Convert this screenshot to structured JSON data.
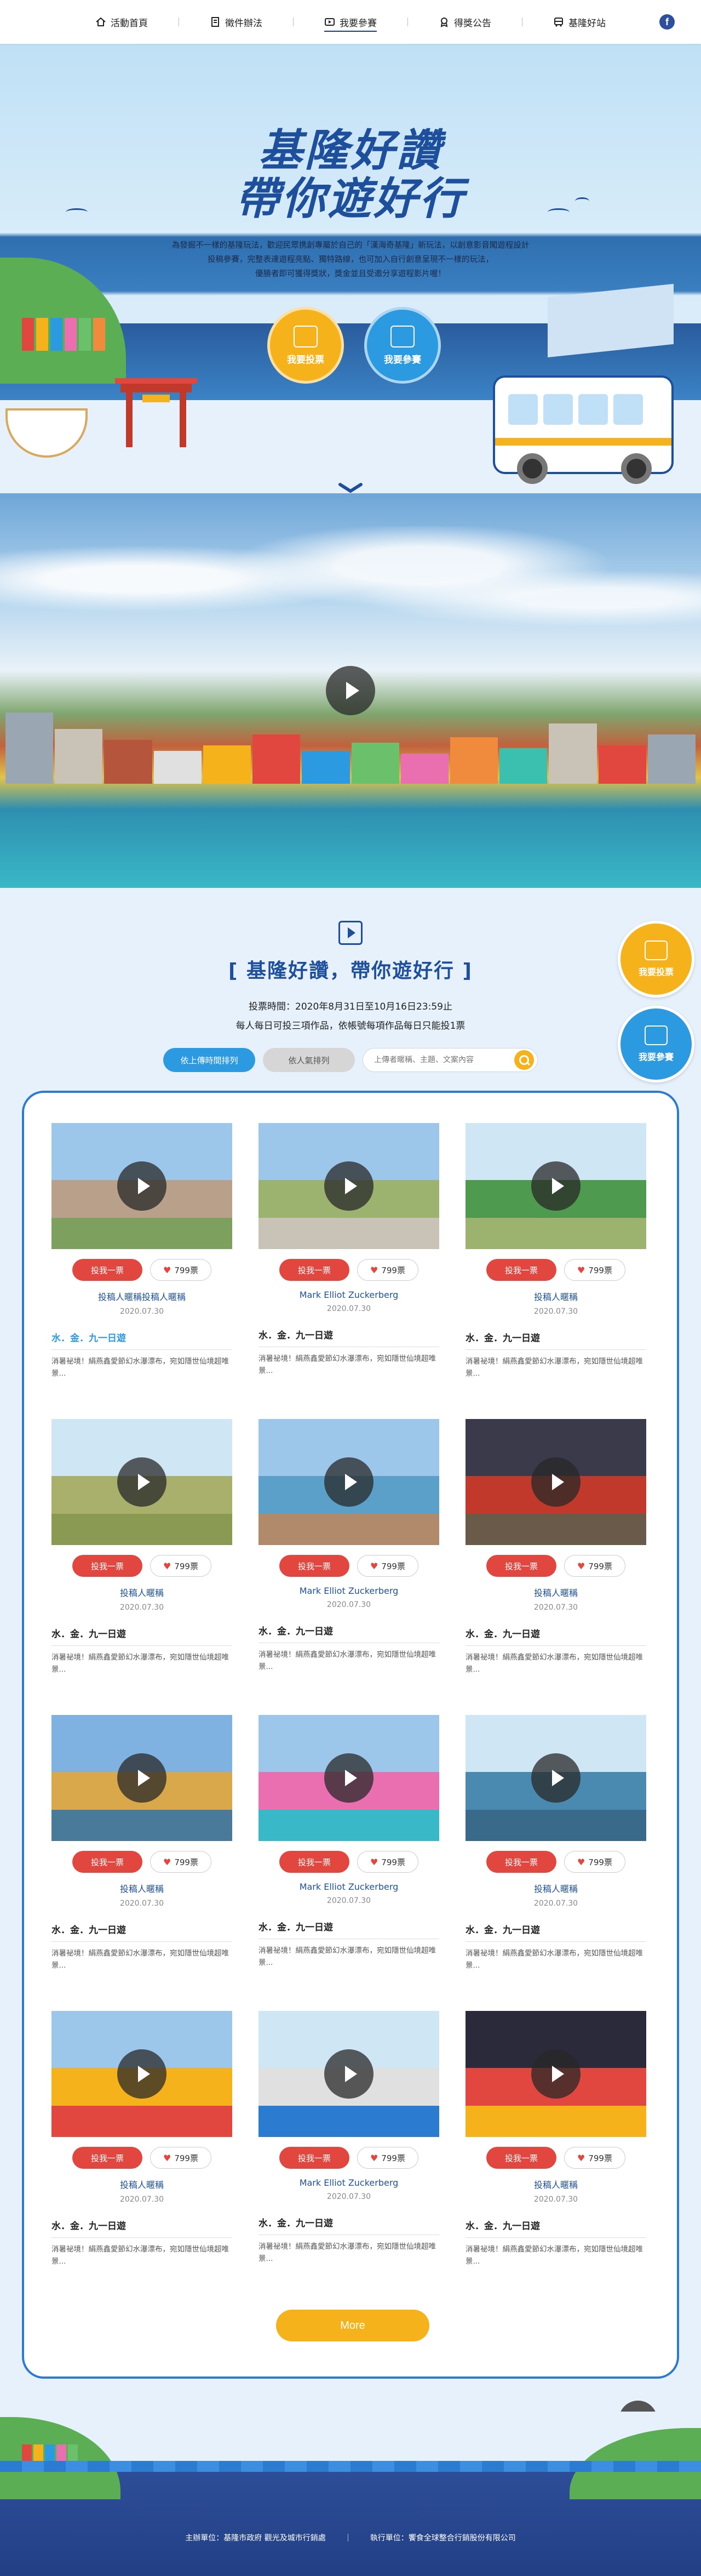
{
  "nav": {
    "items": [
      {
        "label": "活動首頁",
        "icon": "home-icon"
      },
      {
        "label": "徵件辦法",
        "icon": "document-icon"
      },
      {
        "label": "我要參賽",
        "icon": "video-icon",
        "active": true
      },
      {
        "label": "得獎公告",
        "icon": "medal-icon"
      },
      {
        "label": "基隆好站",
        "icon": "bus-icon"
      }
    ],
    "facebook": "f"
  },
  "hero": {
    "title_line1": "基隆好讚",
    "title_line2": "帶你遊好行",
    "desc_line1": "為發掘不一樣的基隆玩法，歡迎民眾携創專屬於自己的「漢海奇基隆」新玩法，以創意影音闖遊程設計",
    "desc_line2": "投稿參賽，完整表達遊程亮點、獨特路線，也可加入自行創意呈現不一樣的玩法，",
    "desc_line3": "優勝者即可獲得獎狀，獎金並且受邀分享遊程影片喔！",
    "vote_button": "我要投票",
    "join_button": "我要參賽"
  },
  "section": {
    "title": "[ 基隆好讚，帶你遊好行 ]",
    "vote_time": "投票時間：2020年8月31日至10月16日23:59止",
    "vote_rule": "每人每日可投三項作品，依帳號每項作品每日只能投1票",
    "sort_latest": "依上傳時間排列",
    "sort_votes": "依人氣排列",
    "search_placeholder": "上傳者暱稱、主題、文案內容",
    "float_vote": "我要投票",
    "float_join": "我要參賽",
    "more_button": "More"
  },
  "cards": [
    {
      "author": "投稿人暱稱投稿人暱稱",
      "date": "2020.07.30",
      "title": "水．金．九一日遊",
      "desc": "消暑祕境！絹燕鑫愛節幻水瀑漂布，宛如隱世仙境超唯景...",
      "votes": "799票",
      "vote_label": "投我一票",
      "link": true
    },
    {
      "author": "Mark Elliot Zuckerberg",
      "date": "2020.07.30",
      "title": "水．金．九一日遊",
      "desc": "消暑祕境！絹燕鑫愛節幻水瀑漂布，宛如隱世仙境超唯景...",
      "votes": "799票",
      "vote_label": "投我一票"
    },
    {
      "author": "投稿人暱稱",
      "date": "2020.07.30",
      "title": "水．金．九一日遊",
      "desc": "消暑祕境！絹燕鑫愛節幻水瀑漂布，宛如隱世仙境超唯景...",
      "votes": "799票",
      "vote_label": "投我一票"
    },
    {
      "author": "投稿人暱稱",
      "date": "2020.07.30",
      "title": "水．金．九一日遊",
      "desc": "消暑祕境！絹燕鑫愛節幻水瀑漂布，宛如隱世仙境超唯景...",
      "votes": "799票",
      "vote_label": "投我一票"
    },
    {
      "author": "Mark Elliot Zuckerberg",
      "date": "2020.07.30",
      "title": "水．金．九一日遊",
      "desc": "消暑祕境！絹燕鑫愛節幻水瀑漂布，宛如隱世仙境超唯景...",
      "votes": "799票",
      "vote_label": "投我一票"
    },
    {
      "author": "投稿人暱稱",
      "date": "2020.07.30",
      "title": "水．金．九一日遊",
      "desc": "消暑祕境！絹燕鑫愛節幻水瀑漂布，宛如隱世仙境超唯景...",
      "votes": "799票",
      "vote_label": "投我一票"
    },
    {
      "author": "投稿人暱稱",
      "date": "2020.07.30",
      "title": "水．金．九一日遊",
      "desc": "消暑祕境！絹燕鑫愛節幻水瀑漂布，宛如隱世仙境超唯景...",
      "votes": "799票",
      "vote_label": "投我一票"
    },
    {
      "author": "Mark Elliot Zuckerberg",
      "date": "2020.07.30",
      "title": "水．金．九一日遊",
      "desc": "消暑祕境！絹燕鑫愛節幻水瀑漂布，宛如隱世仙境超唯景...",
      "votes": "799票",
      "vote_label": "投我一票"
    },
    {
      "author": "投稿人暱稱",
      "date": "2020.07.30",
      "title": "水．金．九一日遊",
      "desc": "消暑祕境！絹燕鑫愛節幻水瀑漂布，宛如隱世仙境超唯景...",
      "votes": "799票",
      "vote_label": "投我一票"
    },
    {
      "author": "投稿人暱稱",
      "date": "2020.07.30",
      "title": "水．金．九一日遊",
      "desc": "消暑祕境！絹燕鑫愛節幻水瀑漂布，宛如隱世仙境超唯景...",
      "votes": "799票",
      "vote_label": "投我一票"
    },
    {
      "author": "Mark Elliot Zuckerberg",
      "date": "2020.07.30",
      "title": "水．金．九一日遊",
      "desc": "消暑祕境！絹燕鑫愛節幻水瀑漂布，宛如隱世仙境超唯景...",
      "votes": "799票",
      "vote_label": "投我一票"
    },
    {
      "author": "投稿人暱稱",
      "date": "2020.07.30",
      "title": "水．金．九一日遊",
      "desc": "消暑祕境！絹燕鑫愛節幻水瀑漂布，宛如隱世仙境超唯景...",
      "votes": "799票",
      "vote_label": "投我一票"
    }
  ],
  "footer": {
    "organizer": "主辦單位：基隆市政府 觀光及城市行銷處",
    "executor": "執行單位：饗食全球整合行銷股份有限公司"
  },
  "colors": {
    "primary_blue": "#1e4f9c",
    "accent_blue": "#2b9ae0",
    "accent_yellow": "#f5b21b",
    "vote_red": "#e2473f"
  }
}
